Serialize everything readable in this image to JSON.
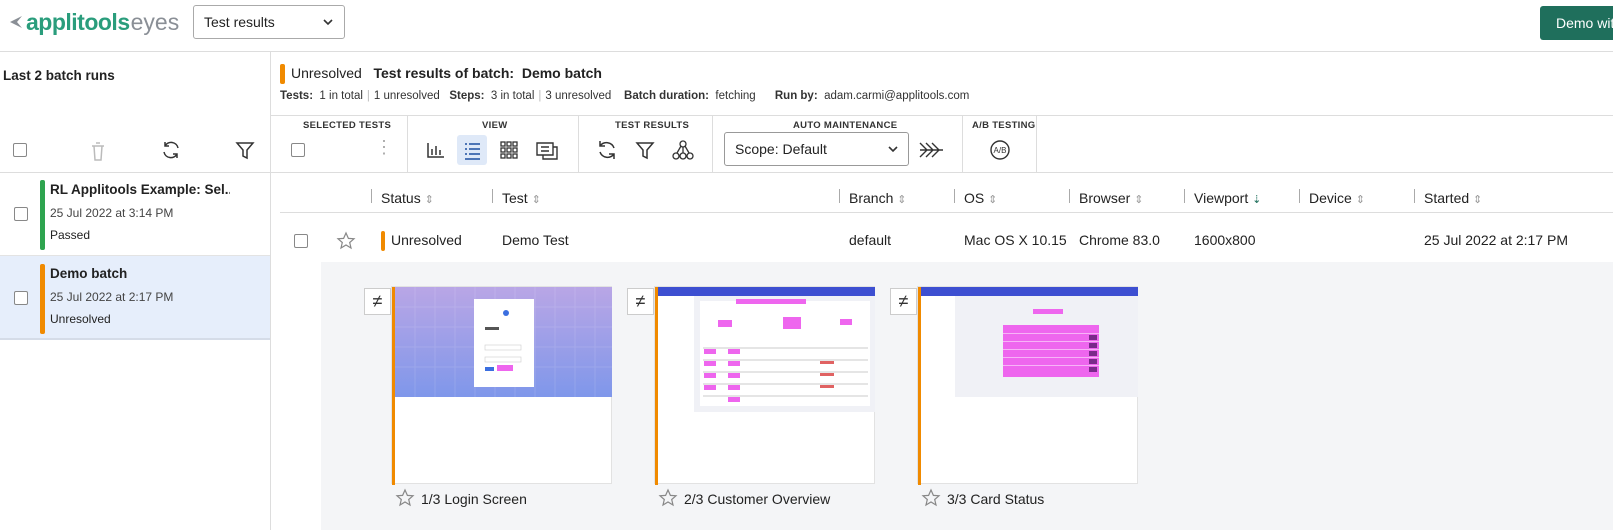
{
  "header": {
    "logo_primary": "applitools",
    "logo_secondary": "eyes",
    "view_dropdown": "Test results",
    "demo_button": "Demo with"
  },
  "left_panel": {
    "title": "Last 2 batch runs",
    "batches": [
      {
        "name": "RL Applitools Example: Sel...",
        "date": "25 Jul 2022 at 3:14 PM",
        "status": "Passed",
        "status_color": "#2ea44f"
      },
      {
        "name": "Demo batch",
        "date": "25 Jul 2022 at 2:17 PM",
        "status": "Unresolved",
        "status_color": "#f08a00"
      }
    ]
  },
  "batch_info": {
    "status": "Unresolved",
    "title_prefix": "Test results of batch:",
    "batch_name": "Demo batch",
    "tests_label": "Tests:",
    "tests_total": "1 in total",
    "tests_unresolved": "1 unresolved",
    "steps_label": "Steps:",
    "steps_total": "3 in total",
    "steps_unresolved": "3 unresolved",
    "duration_label": "Batch duration:",
    "duration_value": "fetching",
    "run_by_label": "Run by:",
    "run_by_value": "adam.carmi@applitools.com"
  },
  "toolbar": {
    "selected_tests": "SELECTED TESTS",
    "view": "VIEW",
    "test_results": "TEST RESULTS",
    "auto_maintenance": "AUTO MAINTENANCE",
    "ab_testing": "A/B TESTING",
    "scope": "Scope: Default"
  },
  "table": {
    "columns": [
      "Status",
      "Test",
      "Branch",
      "OS",
      "Browser",
      "Viewport",
      "Device",
      "Started"
    ],
    "row": {
      "status": "Unresolved",
      "test": "Demo Test",
      "branch": "default",
      "os": "Mac OS X 10.15",
      "browser": "Chrome 83.0",
      "viewport": "1600x800",
      "device": "",
      "started": "25 Jul 2022 at 2:17 PM"
    }
  },
  "steps": [
    {
      "caption": "1/3 Login Screen",
      "badge": "≠"
    },
    {
      "caption": "2/3 Customer Overview",
      "badge": "≠"
    },
    {
      "caption": "3/3 Card Status",
      "badge": "≠"
    }
  ],
  "colors": {
    "accent": "#1f6f5c",
    "unresolved": "#f08a00",
    "passed": "#2ea44f",
    "selected_row": "#e6eefb"
  }
}
